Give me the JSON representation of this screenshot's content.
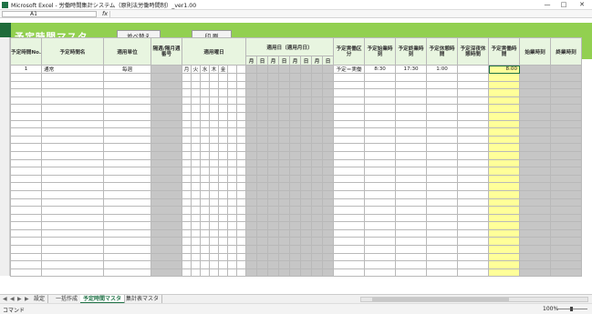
{
  "window": {
    "title": "Microsoft Excel - 労働時間集計システム（原則法労働時間制）_ver1.00",
    "minimize": "—",
    "maximize": "□",
    "close": "✕"
  },
  "formula_bar": {
    "name_box": "A1",
    "fx": "fx",
    "formula": ""
  },
  "banner": {
    "title": "予定時間マスタ",
    "sort_button": "並べ替え",
    "print_button": "印 刷"
  },
  "table": {
    "headers": [
      "予定時間No.",
      "予定時間名",
      "適用単位",
      "隔週/隔月週番号",
      "適用曜日",
      "適用日（適用月日）",
      "予定実働区分",
      "予定始業時刻",
      "予定終業時刻",
      "予定休憩時間",
      "予定深夜休憩時間",
      "予定実働時間",
      "始業時刻",
      "終業時刻"
    ],
    "weekdays": [
      "月",
      "火",
      "水",
      "木",
      "金",
      "",
      ""
    ],
    "days_sub": [
      "月",
      "日",
      "月",
      "日",
      "月",
      "日",
      "月",
      "日"
    ],
    "row1": {
      "no": "1",
      "name": "通常",
      "unit": "毎週",
      "weekdays_checked": [
        "月",
        "火",
        "水",
        "木",
        "金"
      ],
      "kubun": "予定＝実働",
      "start": "8:30",
      "end": "17:30",
      "break": "1:00",
      "actual": "8:00"
    }
  },
  "sheet_tabs": [
    "設定",
    "一括作成",
    "予定時間マスタ",
    "集計表マスタ"
  ],
  "active_tab": "予定時間マスタ",
  "status": {
    "mode": "コマンド",
    "zoom": "100%"
  }
}
